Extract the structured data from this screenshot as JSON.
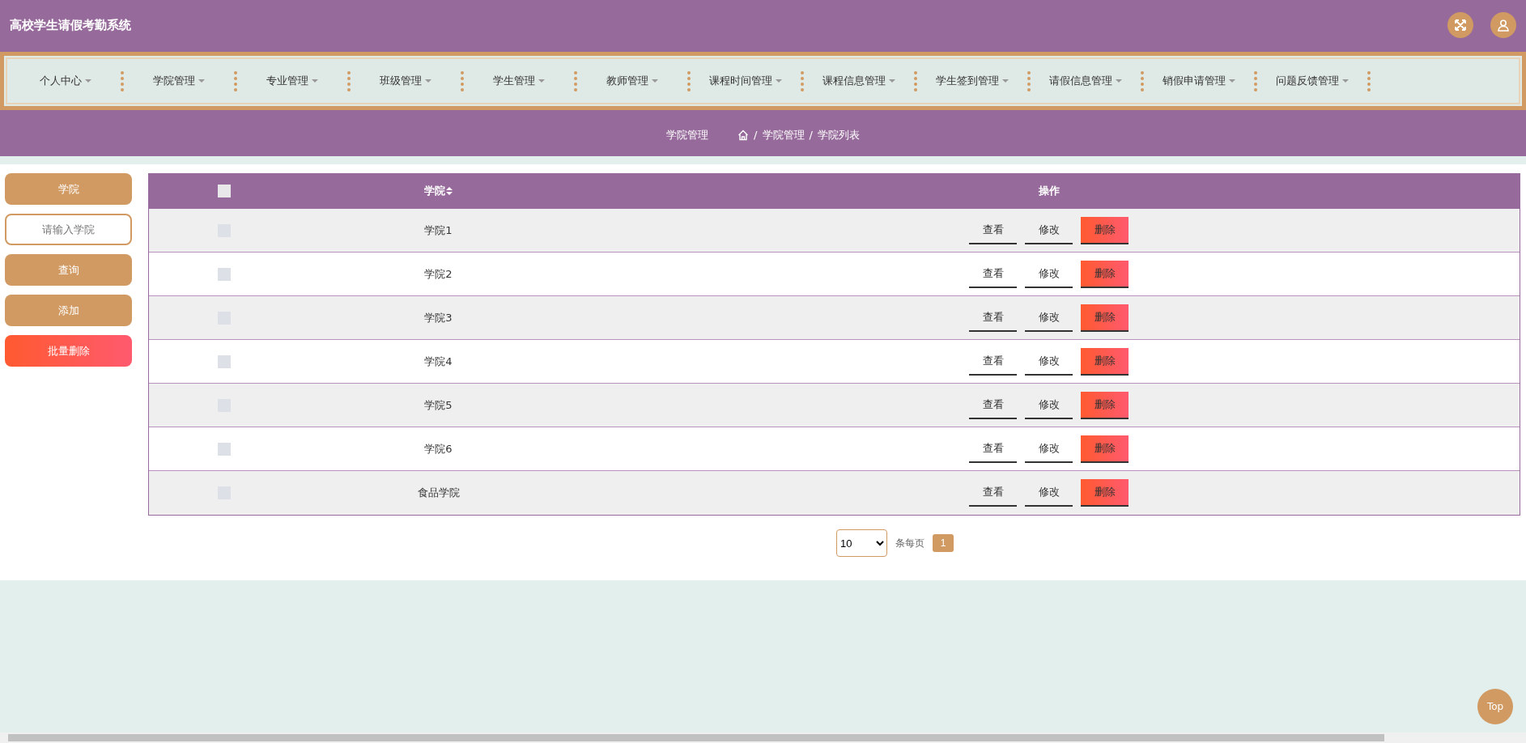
{
  "header": {
    "title": "高校学生请假考勤系统"
  },
  "nav": {
    "items": [
      {
        "label": "个人中心"
      },
      {
        "label": "学院管理"
      },
      {
        "label": "专业管理"
      },
      {
        "label": "班级管理"
      },
      {
        "label": "学生管理"
      },
      {
        "label": "教师管理"
      },
      {
        "label": "课程时间管理"
      },
      {
        "label": "课程信息管理"
      },
      {
        "label": "学生签到管理"
      },
      {
        "label": "请假信息管理"
      },
      {
        "label": "销假申请管理"
      },
      {
        "label": "问题反馈管理"
      }
    ]
  },
  "breadcrumb": {
    "title": "学院管理",
    "separator": "/",
    "path": [
      "学院管理",
      "学院列表"
    ]
  },
  "search": {
    "label": "学院",
    "placeholder": "请输入学院",
    "buttons": [
      {
        "label": "查询",
        "kind": "primary"
      },
      {
        "label": "添加",
        "kind": "primary"
      },
      {
        "label": "批量删除",
        "kind": "danger"
      }
    ]
  },
  "table": {
    "select_all_checked": false,
    "columns": [
      {
        "label": "学院",
        "sortable": true
      },
      {
        "label": "操作",
        "sortable": false
      }
    ],
    "rows": [
      {
        "college": "学院1",
        "checked": false,
        "actions": [
          {
            "label": "查看",
            "kind": "plain"
          },
          {
            "label": "修改",
            "kind": "plain"
          },
          {
            "label": "删除",
            "kind": "danger"
          }
        ]
      },
      {
        "college": "学院2",
        "checked": false,
        "actions": [
          {
            "label": "查看",
            "kind": "plain"
          },
          {
            "label": "修改",
            "kind": "plain"
          },
          {
            "label": "删除",
            "kind": "danger"
          }
        ]
      },
      {
        "college": "学院3",
        "checked": false,
        "actions": [
          {
            "label": "查看",
            "kind": "plain"
          },
          {
            "label": "修改",
            "kind": "plain"
          },
          {
            "label": "删除",
            "kind": "danger"
          }
        ]
      },
      {
        "college": "学院4",
        "checked": false,
        "actions": [
          {
            "label": "查看",
            "kind": "plain"
          },
          {
            "label": "修改",
            "kind": "plain"
          },
          {
            "label": "删除",
            "kind": "danger"
          }
        ]
      },
      {
        "college": "学院5",
        "checked": false,
        "actions": [
          {
            "label": "查看",
            "kind": "plain"
          },
          {
            "label": "修改",
            "kind": "plain"
          },
          {
            "label": "删除",
            "kind": "danger"
          }
        ]
      },
      {
        "college": "学院6",
        "checked": false,
        "actions": [
          {
            "label": "查看",
            "kind": "plain"
          },
          {
            "label": "修改",
            "kind": "plain"
          },
          {
            "label": "删除",
            "kind": "danger"
          }
        ]
      },
      {
        "college": "食品学院",
        "checked": false,
        "actions": [
          {
            "label": "查看",
            "kind": "plain"
          },
          {
            "label": "修改",
            "kind": "plain"
          },
          {
            "label": "删除",
            "kind": "danger"
          }
        ]
      }
    ]
  },
  "pagination": {
    "page_size": "10",
    "page_size_label": "条每页",
    "pages": [
      {
        "label": "1",
        "selected": true
      }
    ]
  },
  "back_to_top": {
    "label": "Top"
  }
}
